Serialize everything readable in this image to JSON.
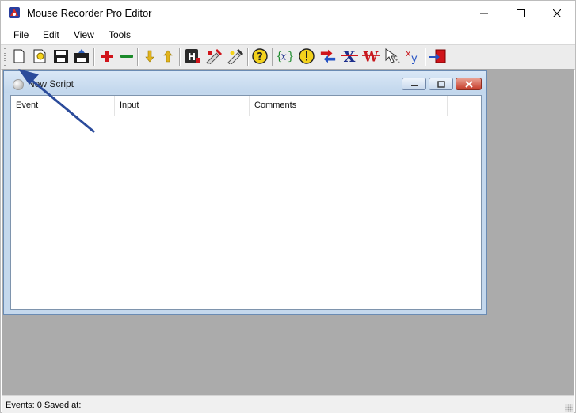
{
  "window": {
    "title": "Mouse Recorder Pro Editor",
    "controls": [
      "minimize",
      "maximize",
      "close"
    ]
  },
  "menu": {
    "items": [
      {
        "label": "File"
      },
      {
        "label": "Edit"
      },
      {
        "label": "View"
      },
      {
        "label": "Tools"
      }
    ]
  },
  "toolbar": {
    "buttons": [
      {
        "icon": "new-script-icon"
      },
      {
        "icon": "open-script-icon"
      },
      {
        "icon": "save-icon"
      },
      {
        "icon": "save-as-icon"
      },
      {
        "icon": "add-event-icon"
      },
      {
        "icon": "remove-event-icon"
      },
      {
        "icon": "move-down-icon"
      },
      {
        "icon": "move-up-icon"
      },
      {
        "icon": "hotkey-icon"
      },
      {
        "icon": "edit-event-icon"
      },
      {
        "icon": "edit-comment-icon"
      },
      {
        "icon": "help-icon"
      },
      {
        "icon": "variable-icon"
      },
      {
        "icon": "info-icon"
      },
      {
        "icon": "swap-icon"
      },
      {
        "icon": "delete-x-icon"
      },
      {
        "icon": "delete-w-icon"
      },
      {
        "icon": "mouse-cursor-icon"
      },
      {
        "icon": "xy-coordinates-icon"
      },
      {
        "icon": "exit-icon"
      }
    ]
  },
  "child_window": {
    "title": "New Script",
    "columns": [
      {
        "label": "Event"
      },
      {
        "label": "Input"
      },
      {
        "label": "Comments"
      }
    ],
    "rows": []
  },
  "status": {
    "text": "Events: 0 Saved at:"
  },
  "colors": {
    "mdi_background": "#ababab",
    "child_frame": "#c4d8ed",
    "annotation_arrow": "#2b4b9b",
    "close_button": "#c63c2a"
  }
}
